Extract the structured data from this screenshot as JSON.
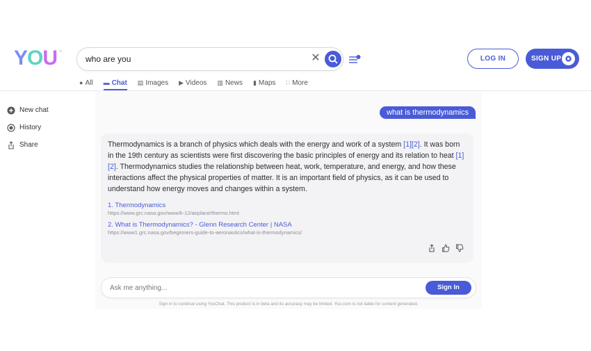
{
  "header": {
    "logo_text": "YOU",
    "search_value": "who are you",
    "login_label": "LOG IN",
    "signup_label": "SIGN UP"
  },
  "tabs": [
    {
      "label": "All",
      "icon": "search-icon"
    },
    {
      "label": "Chat",
      "icon": "chat-icon",
      "active": true
    },
    {
      "label": "Images",
      "icon": "images-icon"
    },
    {
      "label": "Videos",
      "icon": "play-icon"
    },
    {
      "label": "News",
      "icon": "news-icon"
    },
    {
      "label": "Maps",
      "icon": "map-icon"
    },
    {
      "label": "More",
      "icon": "grid-dots-icon"
    }
  ],
  "sidebar": {
    "items": [
      {
        "label": "New chat",
        "icon": "plus-circle-icon"
      },
      {
        "label": "History",
        "icon": "history-icon"
      },
      {
        "label": "Share",
        "icon": "share-icon"
      }
    ]
  },
  "chat": {
    "user_message": "what is thermodynamics",
    "answer_part1": "Thermodynamics is a branch of physics which deals with the energy and work of a system ",
    "cite1": "[1][2]",
    "answer_part2": ". It was born in the 19th century as scientists were first discovering the basic principles of energy and its relation to heat ",
    "cite2": "[1][2]",
    "answer_part3": ". Thermodynamics studies the relationship between heat, work, temperature, and energy, and how these interactions affect the physical properties of matter. It is an important field of physics, as it can be used to understand how energy moves and changes within a system.",
    "sources": [
      {
        "title": "1. Thermodynamics",
        "url": "https://www.grc.nasa.gov/www/k-12/airplane/thermo.html"
      },
      {
        "title": "2. What is Thermodynamics? - Glenn Research Center | NASA",
        "url": "https://www1.grc.nasa.gov/beginners-guide-to-aeronautics/what-is-thermodynamics/"
      }
    ]
  },
  "composer": {
    "placeholder": "Ask me anything...",
    "signin_label": "Sign In",
    "disclaimer": "Sign in to continue using YouChat. This product is in beta and its accuracy may be limited. You.com is not liable for content generated."
  },
  "colors": {
    "accent": "#4a5bd8"
  }
}
